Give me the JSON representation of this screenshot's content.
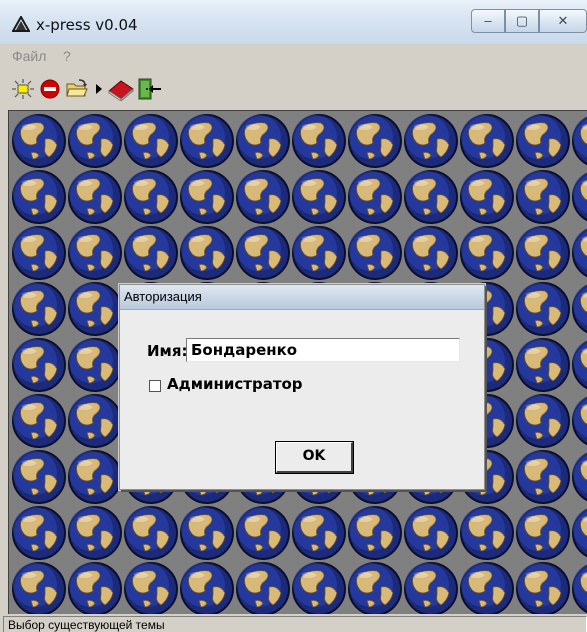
{
  "window": {
    "title": "x-press v0.04",
    "minimize_label": "–",
    "maximize_label": "▢",
    "close_label": "✕"
  },
  "menu": {
    "items": [
      {
        "label": "Файл"
      },
      {
        "label": "?"
      }
    ]
  },
  "toolbar": {
    "icons": [
      "sun-icon",
      "stop-icon",
      "open-folder-icon",
      "arrow-right-icon",
      "book-icon",
      "exit-door-icon"
    ]
  },
  "workspace": {
    "tile_icon": "globe-icon"
  },
  "dialog": {
    "title": "Авторизация",
    "name_label": "Имя:",
    "name_value": "Бондаренко",
    "admin_label": "Администратор",
    "admin_checked": false,
    "ok_label": "OK"
  },
  "status": {
    "text": "Выбор существующей темы"
  },
  "colors": {
    "workspace_bg": "#808080",
    "globe_blue": "#1b2a7a",
    "globe_land": "#d8b978"
  }
}
